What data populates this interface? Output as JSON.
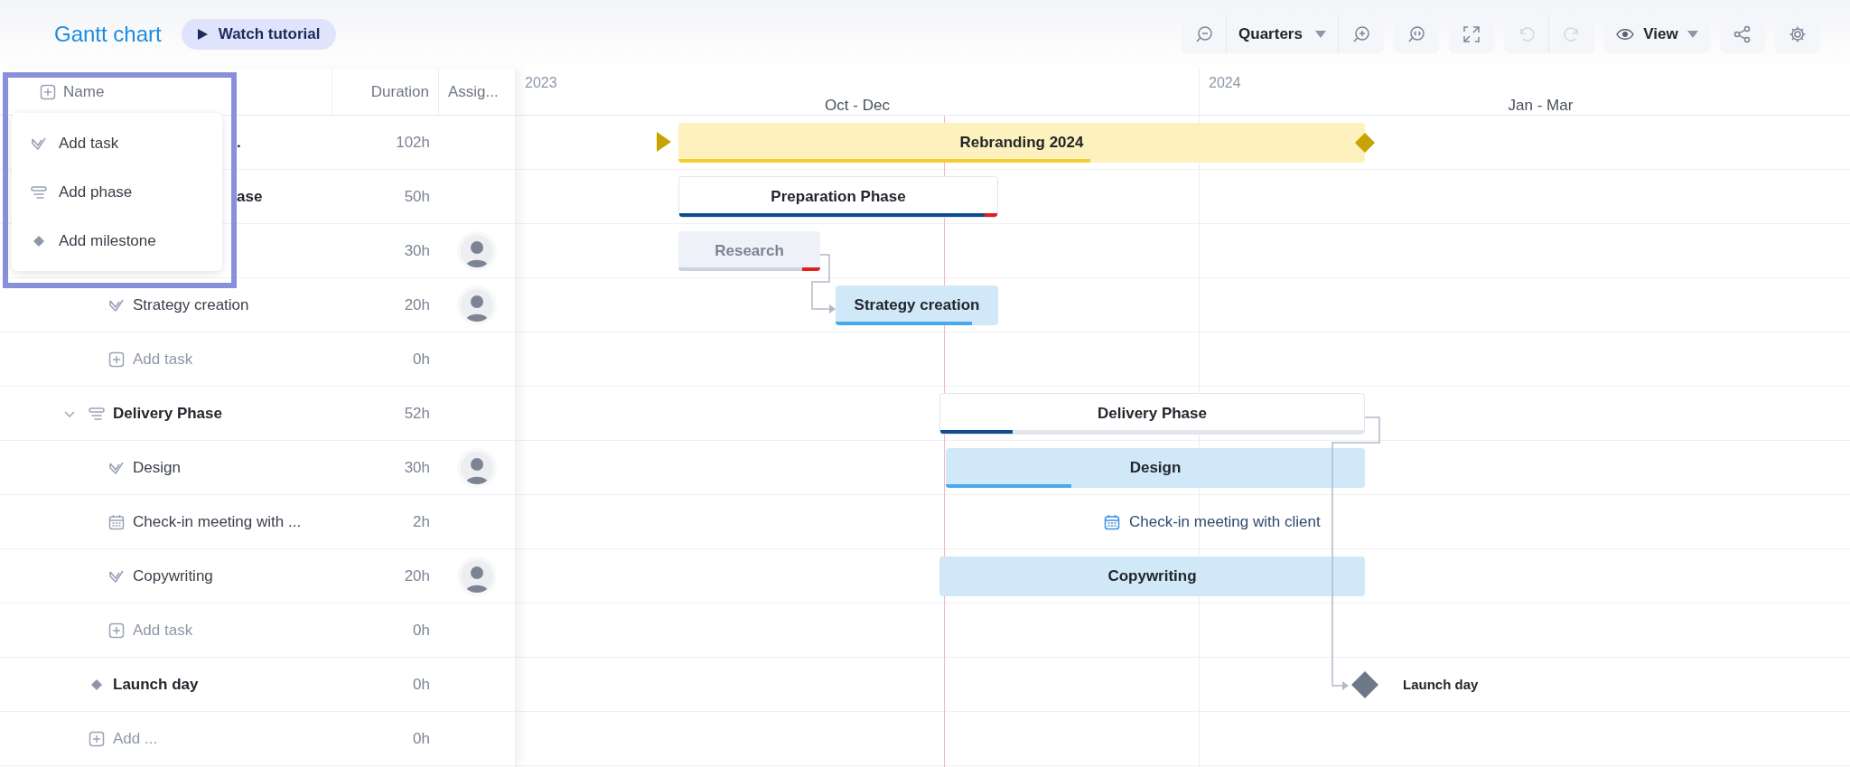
{
  "header": {
    "title": "Gantt chart",
    "tutorial_button": "Watch tutorial"
  },
  "toolbar": {
    "scale": "Quarters",
    "view": "View",
    "undo_disabled": true,
    "redo_disabled": true
  },
  "table": {
    "columns": [
      "Name",
      "Duration",
      "Assig..."
    ],
    "rows": [
      {
        "kind": "project",
        "name": ".",
        "covered": true,
        "duration": "102h",
        "assigned": false,
        "children": [
          {
            "kind": "phase",
            "name": "ase",
            "covered": true,
            "duration": "50h",
            "assigned": false,
            "children": [
              {
                "kind": "task",
                "covered": true,
                "duration": "30h",
                "assigned": true
              },
              {
                "kind": "task",
                "name": "Strategy creation",
                "covered": false,
                "duration": "20h",
                "assigned": true
              },
              {
                "kind": "add",
                "name": "Add task",
                "covered": false,
                "duration": "0h",
                "assigned": false
              }
            ]
          },
          {
            "kind": "phase",
            "name": "Delivery Phase",
            "covered": false,
            "expanded": true,
            "duration": "52h",
            "assigned": false,
            "children": [
              {
                "kind": "task",
                "name": "Design",
                "covered": false,
                "duration": "30h",
                "assigned": true
              },
              {
                "kind": "meeting",
                "name": "Check-in meeting with ...",
                "covered": false,
                "duration": "2h",
                "assigned": false
              },
              {
                "kind": "task",
                "name": "Copywriting",
                "covered": false,
                "duration": "20h",
                "assigned": true
              },
              {
                "kind": "add",
                "name": "Add task",
                "covered": false,
                "duration": "0h",
                "assigned": false
              }
            ]
          },
          {
            "kind": "milestone",
            "name": "Launch day",
            "covered": false,
            "duration": "0h",
            "assigned": false
          },
          {
            "kind": "add",
            "name": "Add ...",
            "covered": false,
            "duration": "0h",
            "assigned": false
          }
        ]
      }
    ]
  },
  "add_menu": {
    "items": [
      {
        "kind": "task",
        "label": "Add task"
      },
      {
        "kind": "phase",
        "label": "Add phase"
      },
      {
        "kind": "milestone",
        "label": "Add milestone"
      }
    ]
  },
  "timeline": {
    "years": [
      "2023",
      "2024"
    ],
    "quarters": [
      "Oct - Dec",
      "Jan - Mar"
    ],
    "bars": [
      {
        "kind": "project",
        "label": "Rebranding 2024",
        "level": 0.6
      },
      {
        "kind": "phase",
        "label": "Preparation Phase",
        "level": 0.96,
        "overdue": true
      },
      {
        "kind": "task",
        "label": "Research",
        "level": 0.87,
        "overdue": true,
        "faded": true
      },
      {
        "kind": "task",
        "label": "Strategy creation",
        "level": 0.84,
        "overdue": false,
        "faded": false
      },
      {
        "kind": "phase",
        "label": "Delivery Phase",
        "level": 0.17,
        "overdue": false
      },
      {
        "kind": "task",
        "label": "Design",
        "level": 0.3,
        "overdue": false,
        "faded": false
      },
      {
        "kind": "meeting",
        "label": "Check-in meeting with client"
      },
      {
        "kind": "task",
        "label": "Copywriting",
        "faded": false
      },
      {
        "kind": "milestone",
        "label": "Launch day"
      }
    ]
  }
}
